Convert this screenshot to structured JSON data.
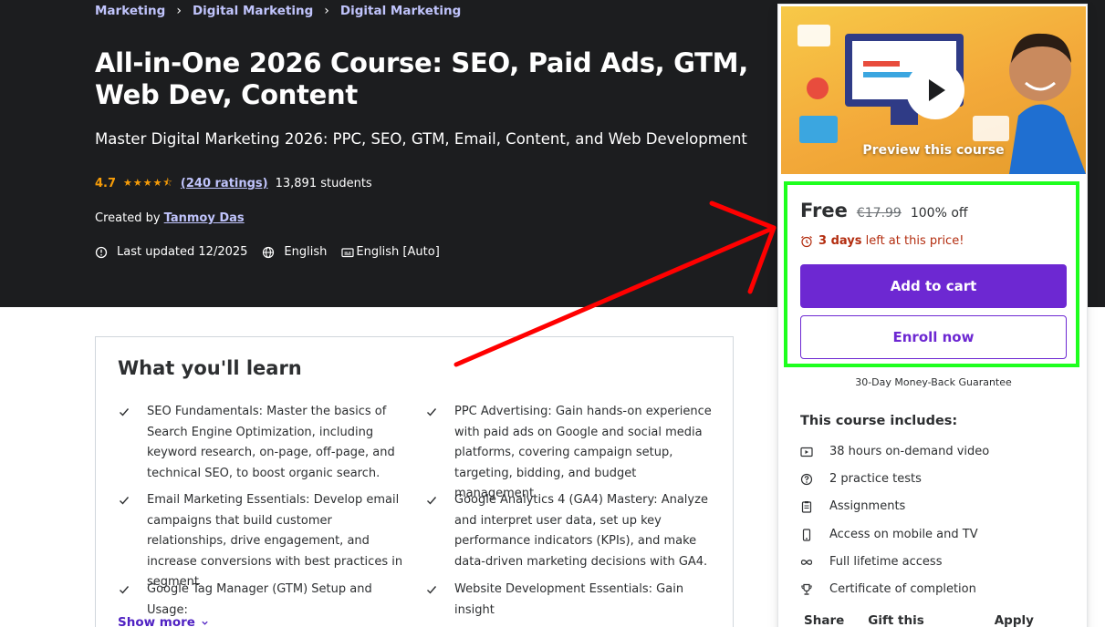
{
  "breadcrumb": [
    "Marketing",
    "Digital Marketing",
    "Digital Marketing"
  ],
  "course": {
    "title": "All-in-One 2026 Course: SEO, Paid Ads, GTM, Web Dev, Content",
    "subtitle": "Master Digital Marketing 2026: PPC, SEO, GTM, Email, Content, and Web Development",
    "rating": "4.7",
    "stars": "★★★★⯪",
    "ratings_count": "(240 ratings)",
    "students": "13,891 students",
    "created_by_label": "Created by",
    "instructor": "Tanmoy Das",
    "last_updated": "Last updated 12/2025",
    "language": "English",
    "captions": "English [Auto]"
  },
  "learn": {
    "heading": "What you'll learn",
    "items": [
      "SEO Fundamentals: Master the basics of Search Engine Optimization, including keyword research, on-page, off-page, and technical SEO, to boost organic search.",
      "PPC Advertising: Gain hands-on experience with paid ads on Google and social media platforms, covering campaign setup, targeting, bidding, and budget management",
      "Email Marketing Essentials: Develop email campaigns that build customer relationships, drive engagement, and increase conversions with best practices in segment",
      "Google Analytics 4 (GA4) Mastery: Analyze and interpret user data, set up key performance indicators (KPIs), and make data-driven marketing decisions with GA4.",
      "Google Tag Manager (GTM) Setup and Usage:",
      "Website Development Essentials: Gain insight"
    ],
    "show_more": "Show more"
  },
  "sidebar": {
    "preview_label": "Preview this course",
    "price": "Free",
    "original_price": "€17.99",
    "discount": "100% off",
    "timer_days": "3 days",
    "timer_rest": "left at this price!",
    "add_to_cart": "Add to cart",
    "enroll_now": "Enroll now",
    "guarantee": "30-Day Money-Back Guarantee",
    "includes_title": "This course includes:",
    "includes": [
      {
        "icon": "video-icon",
        "label": "38 hours on-demand video"
      },
      {
        "icon": "question-circle-icon",
        "label": "2 practice tests"
      },
      {
        "icon": "clipboard-icon",
        "label": "Assignments"
      },
      {
        "icon": "mobile-icon",
        "label": "Access on mobile and TV"
      },
      {
        "icon": "infinity-icon",
        "label": "Full lifetime access"
      },
      {
        "icon": "trophy-icon",
        "label": "Certificate of completion"
      }
    ],
    "actions": [
      "Share",
      "Gift this course",
      "Apply Coupon"
    ]
  },
  "colors": {
    "hero_bg": "#1c1d1f",
    "accent_purple": "#6d28d2",
    "link_lavender": "#c0c4fc",
    "star_orange": "#f69c08",
    "timer_red": "#b32d0f",
    "annotation_green": "#1eff1e",
    "annotation_red": "#ff0000"
  }
}
